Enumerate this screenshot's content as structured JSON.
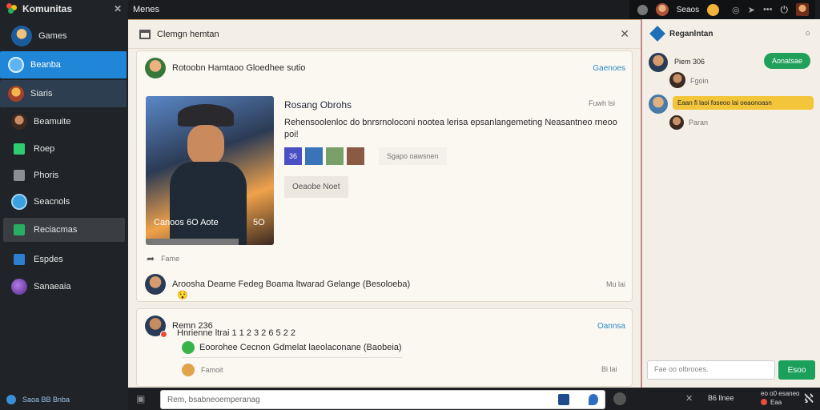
{
  "app": {
    "title": "Komunitas"
  },
  "sidebar": {
    "items": [
      {
        "label": "Games",
        "icon": "avatar-icon"
      },
      {
        "label": "Beanba",
        "icon": "globe-icon"
      },
      {
        "label": "Siaris",
        "icon": "character-icon"
      },
      {
        "label": "Beamuite",
        "icon": "avatar-icon"
      },
      {
        "label": "Roep",
        "icon": "grid-icon"
      },
      {
        "label": "Phoris",
        "icon": "grid-icon"
      },
      {
        "label": "Seacnols",
        "icon": "globe-icon"
      },
      {
        "label": "Reciacmas",
        "icon": "grid-icon"
      },
      {
        "label": "Espdes",
        "icon": "square-icon"
      },
      {
        "label": "Sanaeaia",
        "icon": "orb-icon"
      }
    ],
    "footer": "Saoa BB Bnba"
  },
  "topbar": {
    "title": "Menes",
    "right_label": "Seaos"
  },
  "main": {
    "header": "Clemgn hemtan",
    "post": {
      "author_line": "Rotoobn  Hamtaoo Gloedhee sutio",
      "action": "Gaenoes",
      "card_title": "Rosang Obrohs",
      "time": "Fuwh lsi",
      "description": "Rehensoolenloc do bnrsrnoloconi nootea  lerisa  epsanlangemeting Neasantneo rneoo poi!",
      "game_caption": "Canoos 6O Aote",
      "game_badge": "5O",
      "chips": [
        "36"
      ],
      "chips_note": "Sgapo oawsnen",
      "button": "Oeaobe Noet",
      "share_label": "Fame",
      "comment": "Aroosha Deame Fedeg Boama ltwarad Gelange (Besoloeba)",
      "comment_emoji": "😯",
      "comment_time": "Mu lai"
    },
    "post2": {
      "author": "Remn 236",
      "action": "Oannsa",
      "line": "Hnrienne ltrai 1 1 2 3 2 6 5 2 2",
      "reply": "Eoorohee Cecnon Gdmelat laeolaconane (Baobeia)",
      "reply_author": "Famoit",
      "time": "Bi lai"
    }
  },
  "chat": {
    "header": "Reganlntan",
    "messages": [
      {
        "name": "Piem 306",
        "sub": "Fgoin",
        "bubble": "Aonatsae"
      },
      {
        "bubble": "Eaan fi laoi foseoo lai oeaonoasn",
        "sub": "Paran"
      }
    ],
    "input_placeholder": "Fae oo olbrooes.",
    "send": "Esoo"
  },
  "bottombar": {
    "compose_placeholder": "Rem, bsabneoemperanag",
    "right_label": "B6 llnee",
    "right_status": "eo o0 esaneo",
    "right_status2": "Eaa"
  },
  "colors": {
    "accent": "#1f86d8",
    "success": "#1aa05a",
    "chat_bubble": "#f3c53b"
  }
}
